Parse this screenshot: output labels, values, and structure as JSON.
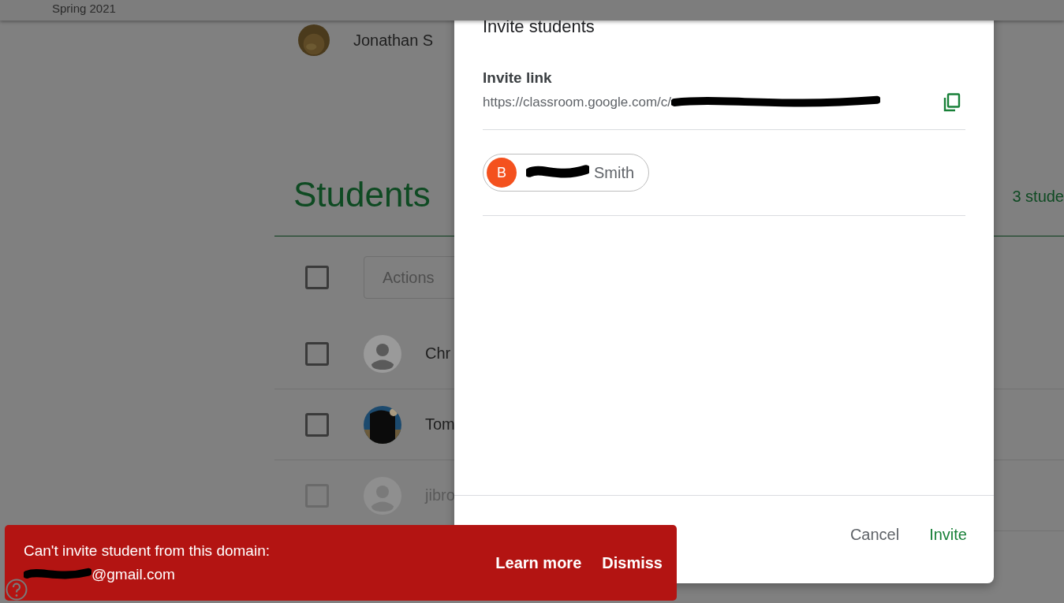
{
  "course": {
    "term": "Spring 2021",
    "teacher": {
      "name": "Jonathan S"
    }
  },
  "students_section": {
    "title": "Students",
    "count": "3 stude",
    "actions": {
      "label": "Actions"
    },
    "select_all": {
      "checked": false
    },
    "rows": [
      {
        "name": "Chr",
        "kind": "default",
        "checked": false,
        "pending": false
      },
      {
        "name": "Tom",
        "checked": false,
        "pending": false
      },
      {
        "name": "jibro",
        "kind": "default",
        "checked": false,
        "pending": true
      }
    ]
  },
  "dialog": {
    "title": "Invite students",
    "link_label": "Invite link",
    "link": "https://classroom.google.com/c/",
    "invitees": [
      {
        "initial": "B",
        "name": "Smith",
        "color": "#f4511e"
      }
    ],
    "buttons": [
      {
        "label": "Cancel",
        "kind": "text"
      },
      {
        "label": "Invite",
        "kind": "primary"
      }
    ]
  },
  "snackbar": {
    "message": "Can't invite student from this domain:",
    "email": "@gmail.com",
    "actions": [
      "Learn more",
      "Dismiss"
    ]
  }
}
